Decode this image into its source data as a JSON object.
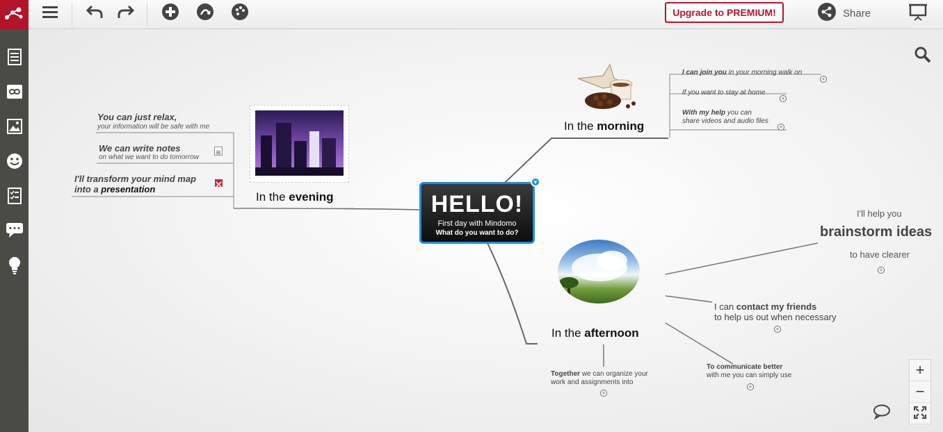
{
  "toolbar": {
    "upgrade_label": "Upgrade to PREMIUM!",
    "share_label": "Share",
    "icons": [
      "menu-icon",
      "undo-icon",
      "redo-icon",
      "add-topic-icon",
      "relationship-icon",
      "theme-icon",
      "presentation-icon"
    ]
  },
  "sidebar": {
    "items": [
      "notes-icon",
      "link-icon",
      "image-icon",
      "emoji-icon",
      "task-icon",
      "comments-icon",
      "idea-icon"
    ]
  },
  "map": {
    "central": {
      "title": "HELLO!",
      "subtitle": "First day with Mindomo",
      "question": "What do you want to do?"
    },
    "evening": {
      "prefix": "In the ",
      "bold": "evening",
      "subtopics": [
        {
          "main": "You can just relax,",
          "sub": "your information will be safe with me"
        },
        {
          "main": "We can write notes",
          "sub": "on what we want to do tomorrow"
        },
        {
          "line1": "I'll transform your mind map",
          "line2_prefix": "into a ",
          "line2_bold": "presentation"
        }
      ]
    },
    "morning": {
      "prefix": "In the ",
      "bold": "morning",
      "subtopics": [
        {
          "bold": "I can join you",
          "rest": " in your morning walk on"
        },
        {
          "text": "If you want to stay at home"
        },
        {
          "bold": "With my help",
          "rest": " you can",
          "line2": "share videos and audio files"
        }
      ]
    },
    "afternoon": {
      "prefix": "In the ",
      "bold": "afternoon",
      "subtopics": [
        {
          "pre": "I'll help you",
          "big": "brainstorm ideas",
          "post": "to have clearer"
        },
        {
          "prefix": "I can ",
          "bold": "contact my friends",
          "line2": "to help us out when necessary"
        },
        {
          "bold": "To communicate better",
          "line2": "with me you can simply use"
        },
        {
          "bold": "Together",
          "rest": " we can organize your",
          "line2": "work and assignments into"
        }
      ]
    }
  },
  "zoom": {
    "in": "+",
    "out": "−"
  }
}
